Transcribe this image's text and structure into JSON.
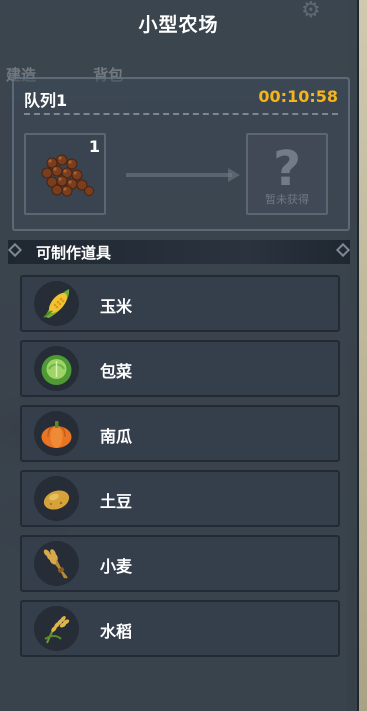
{
  "window": {
    "title": "小型农场"
  },
  "background": {
    "tabs": [
      "建造",
      "背包"
    ]
  },
  "queue": {
    "title": "队列1",
    "timer": "00:10:58",
    "input": {
      "icon": "seed-pile-icon",
      "count": "1"
    },
    "output": {
      "icon": "question-mark-icon",
      "caption": "暂未获得"
    }
  },
  "section": {
    "title": "可制作道具"
  },
  "items": [
    {
      "label": "玉米",
      "icon": "corn-icon"
    },
    {
      "label": "包菜",
      "icon": "cabbage-icon"
    },
    {
      "label": "南瓜",
      "icon": "pumpkin-icon"
    },
    {
      "label": "土豆",
      "icon": "potato-icon"
    },
    {
      "label": "小麦",
      "icon": "wheat-icon"
    },
    {
      "label": "水稻",
      "icon": "rice-icon"
    }
  ],
  "colors": {
    "timer": "#f4b41a",
    "panel": "#2e3844",
    "row": "#353f4b"
  }
}
